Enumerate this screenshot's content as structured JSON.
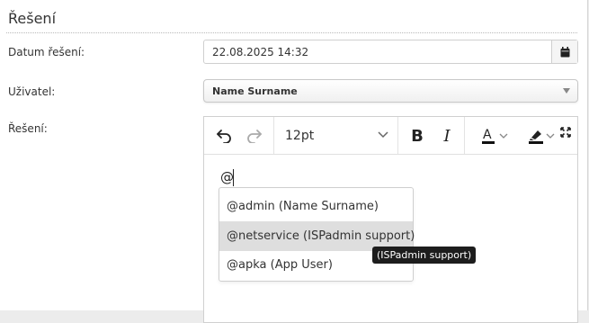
{
  "section": {
    "title": "Řešení"
  },
  "fields": {
    "date_label": "Datum řešení:",
    "date_value": "22.08.2025 14:32",
    "user_label": "Uživatel:",
    "user_value": "Name Surname",
    "solution_label": "Řešení:"
  },
  "toolbar": {
    "font_size": "12pt",
    "icons": [
      "undo-icon",
      "redo-icon",
      "chevron-down-icon",
      "bold-icon",
      "italic-icon",
      "text-color-icon",
      "highlight-icon",
      "fullscreen-icon"
    ]
  },
  "editor": {
    "content": "@"
  },
  "mentions": {
    "items": [
      {
        "label": "@admin (Name Surname)"
      },
      {
        "label": "@netservice (ISPadmin support)"
      },
      {
        "label": "@apka (App User)"
      }
    ],
    "tooltip": "(ISPadmin support)"
  },
  "colors": {
    "accent_bar": "#111111",
    "highlight_row": "#dedede"
  }
}
